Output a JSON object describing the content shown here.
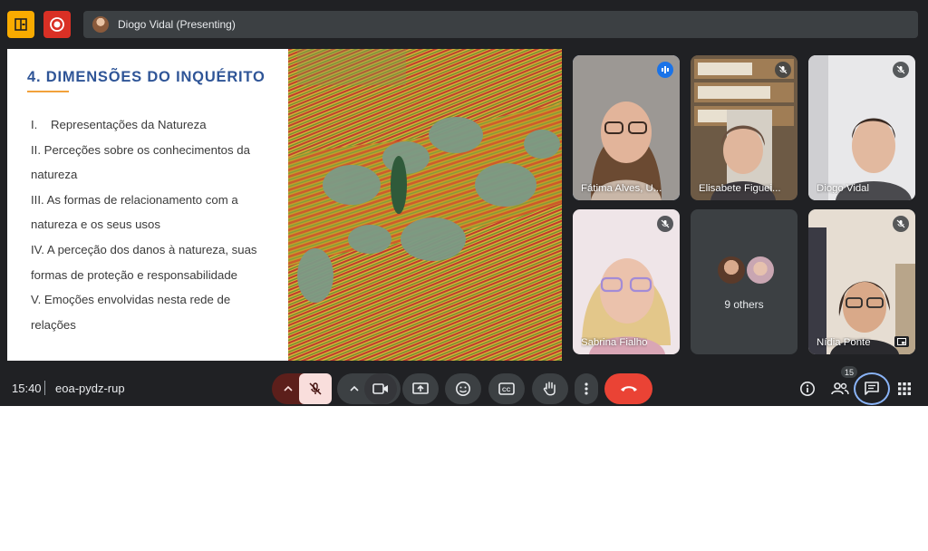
{
  "top_bar": {
    "presenter_label": "Diogo Vidal (Presenting)",
    "icons": [
      "panel-icon",
      "record-icon"
    ],
    "colors": {
      "panel": "#f9ab00",
      "record": "#d93025"
    }
  },
  "slide": {
    "title": "4. DIMENSÕES DO INQUÉRITO",
    "items": [
      "I.    Representações da Natureza",
      "II. Perceções sobre os conhecimentos da",
      "natureza",
      "III. As formas de relacionamento com a",
      "natureza e os seus usos",
      "IV. A perceção dos danos à natureza, suas",
      "formas de proteção e responsabilidade",
      "V. Emoções envolvidas nesta rede de",
      "relações"
    ],
    "colors": {
      "title": "#2f5597",
      "underline": "#f2a13b"
    }
  },
  "participants": [
    {
      "name": "Fátima Alves, U...",
      "status": "speaking"
    },
    {
      "name": "Elisabete Figuei...",
      "status": "muted"
    },
    {
      "name": "Diogo Vidal",
      "status": "muted"
    },
    {
      "name": "Sabrina Fialho",
      "status": "muted"
    },
    {
      "name": "9 others",
      "status": "group"
    },
    {
      "name": "Nídia Ponte",
      "status": "muted"
    }
  ],
  "bottom_bar": {
    "time": "15:40",
    "meeting_code": "eoa-pydz-rup",
    "people_count": "15",
    "controls": [
      "mic-options",
      "microphone-off",
      "camera-options",
      "camera",
      "present-screen",
      "reactions",
      "captions",
      "raise-hand",
      "more-options",
      "leave-call"
    ],
    "right_controls": [
      "meeting-details",
      "people",
      "chat",
      "activities"
    ],
    "colors": {
      "leave": "#ea4335",
      "mic_off_bg": "#f9dedc",
      "chat_ring": "#8ab4f8"
    }
  }
}
